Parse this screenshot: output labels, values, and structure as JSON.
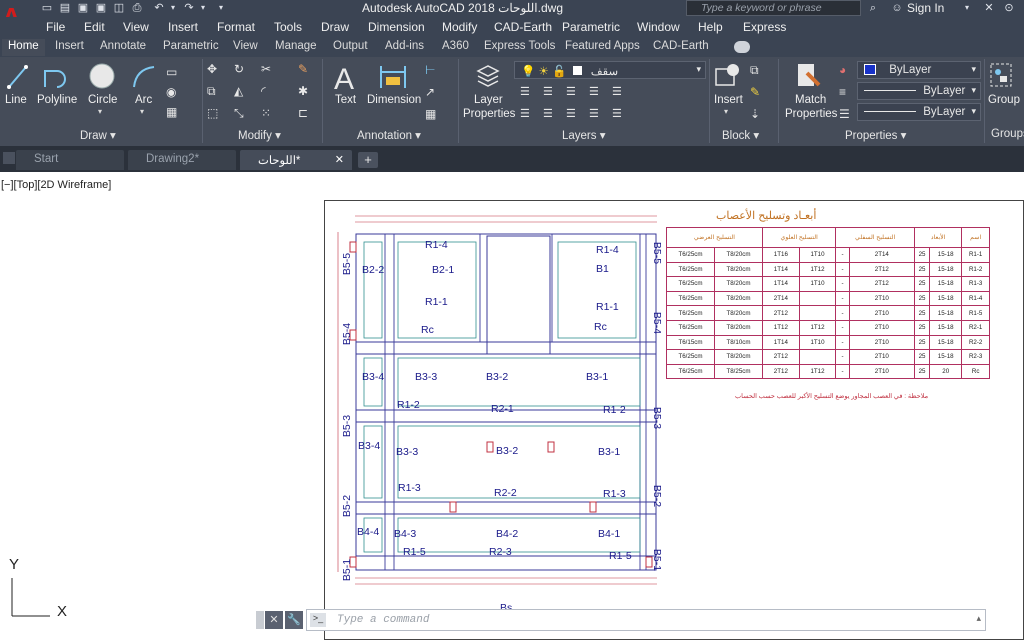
{
  "title_bar": {
    "title": "Autodesk AutoCAD 2018   اللوحات.dwg",
    "search_placeholder": "Type a keyword or phrase",
    "sign_in": "Sign In"
  },
  "menu": [
    "File",
    "Edit",
    "View",
    "Insert",
    "Format",
    "Tools",
    "Draw",
    "Dimension",
    "Modify",
    "CAD-Earth",
    "Parametric",
    "Window",
    "Help",
    "Express"
  ],
  "ribbon_tabs": [
    "Home",
    "Insert",
    "Annotate",
    "Parametric",
    "View",
    "Manage",
    "Output",
    "Add-ins",
    "A360",
    "Express Tools",
    "Featured Apps",
    "CAD-Earth"
  ],
  "ribbon": {
    "draw": {
      "line": "Line",
      "polyline": "Polyline",
      "circle": "Circle",
      "arc": "Arc",
      "panel": "Draw ▾"
    },
    "modify": {
      "panel": "Modify ▾"
    },
    "annotation": {
      "text": "Text",
      "dimension": "Dimension",
      "panel": "Annotation ▾"
    },
    "layers": {
      "layer_properties_1": "Layer",
      "layer_properties_2": "Properties",
      "current_layer": "سقف",
      "panel": "Layers ▾"
    },
    "block": {
      "insert": "Insert",
      "panel": "Block ▾"
    },
    "properties": {
      "match_1": "Match",
      "match_2": "Properties",
      "color": "ByLayer",
      "linetype": "ByLayer",
      "lineweight": "ByLayer",
      "panel": "Properties ▾"
    },
    "groups": {
      "group": "Group",
      "panel": "Groups"
    }
  },
  "doc_tabs": [
    "Start",
    "Drawing2*",
    "اللوحات*"
  ],
  "viewport_label": "[−][Top][2D Wireframe]",
  "ucs": {
    "x": "X",
    "y": "Y"
  },
  "command": {
    "placeholder": "Type a command"
  },
  "drawing": {
    "table_title": "أبعـاد وتسليح الأعصاب",
    "header_groups": [
      "التسليح العرضي",
      "التسليح العلوي",
      "التسليح السفلي",
      "الأبعاد",
      "اسم"
    ],
    "rows": [
      [
        "T6/25cm",
        "T8/20cm",
        "1T16",
        "1T10",
        "-",
        "2T14",
        "25",
        "15-18",
        "R1-1"
      ],
      [
        "T6/25cm",
        "T8/20cm",
        "1T14",
        "1T12",
        "-",
        "2T12",
        "25",
        "15-18",
        "R1-2"
      ],
      [
        "T6/25cm",
        "T8/20cm",
        "1T14",
        "1T10",
        "-",
        "2T12",
        "25",
        "15-18",
        "R1-3"
      ],
      [
        "T6/25cm",
        "T8/20cm",
        "2T14",
        "",
        "-",
        "2T10",
        "25",
        "15-18",
        "R1-4"
      ],
      [
        "T6/25cm",
        "T8/20cm",
        "2T12",
        "",
        "-",
        "2T10",
        "25",
        "15-18",
        "R1-5"
      ],
      [
        "T6/25cm",
        "T8/20cm",
        "1T12",
        "1T12",
        "-",
        "2T10",
        "25",
        "15-18",
        "R2-1"
      ],
      [
        "T6/15cm",
        "T8/10cm",
        "1T14",
        "1T10",
        "-",
        "2T10",
        "25",
        "15-18",
        "R2-2"
      ],
      [
        "T6/25cm",
        "T8/20cm",
        "2T12",
        "",
        "-",
        "2T10",
        "25",
        "15-18",
        "R2-3"
      ],
      [
        "T6/25cm",
        "T8/25cm",
        "2T12",
        "1T12",
        "-",
        "2T10",
        "25",
        "20",
        "Rc"
      ]
    ],
    "note": "ملاحظة : في العصب المجاور يوضع التسليح الأكبر للعصب حسب الحساب",
    "plan_labels": {
      "r14a": "R1-4",
      "r14b": "R1-4",
      "b21": "B2-1",
      "b1": "B1",
      "b22": "B2-2",
      "r11a": "R1-1",
      "r11b": "R1-1",
      "rca": "Rc",
      "rcb": "Rc",
      "b34": "B3-4",
      "b33": "B3-3",
      "b32": "B3-2",
      "b31": "B3-1",
      "r12a": "R1-2",
      "r21": "R2-1",
      "r12b": "R1-2",
      "b34b": "B3-4",
      "b33b": "B3-3",
      "b32b": "B3-2",
      "b31b": "B3-1",
      "r13a": "R1-3",
      "r22": "R2-2",
      "r13b": "R1-3",
      "b44": "B4-4",
      "b43": "B4-3",
      "b42": "B4-2",
      "b41": "B4-1",
      "r15a": "R1-5",
      "r23": "R2-3",
      "r15b": "R1-5",
      "b55": "B5-5",
      "b54": "B5-4",
      "b53": "B5-3",
      "b52": "B5-2",
      "b51": "B5-1",
      "b55r": "B5-5",
      "b54r": "B5-4",
      "b53r": "B5-3",
      "b52r": "B5-2",
      "b51r": "B5-1",
      "bs": "Bs"
    }
  }
}
